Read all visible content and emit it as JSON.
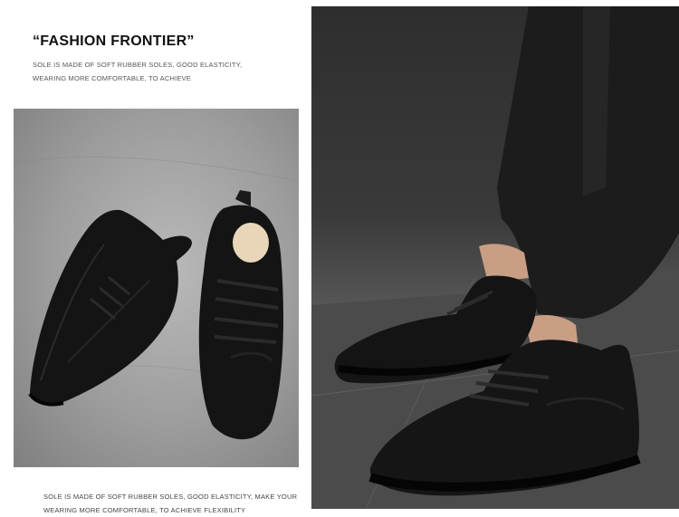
{
  "header": {
    "title": "“FASHION FRONTIER”",
    "subtitle_line1": "SOLE IS MADE OF SOFT RUBBER SOLES, GOOD ELASTICITY,",
    "subtitle_line2": "WEARING MORE COMFORTABLE, TO ACHIEVE"
  },
  "footer": {
    "caption_line1": "SOLE IS MADE OF SOFT RUBBER SOLES, GOOD ELASTICITY, MAKE YOUR",
    "caption_line2": "WEARING MORE COMFORTABLE, TO ACHIEVE FLEXIBILITY"
  },
  "colors": {
    "shoe": "#141414",
    "floor_left": "#a4a4a4",
    "background_right": "#333333"
  },
  "images": {
    "left": "product-photo-top-view",
    "right": "product-photo-worn"
  }
}
